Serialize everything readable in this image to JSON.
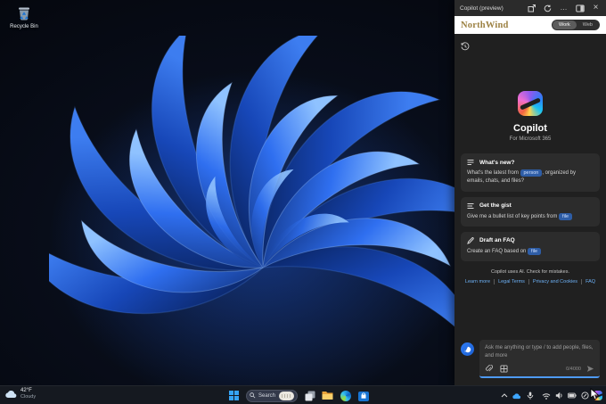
{
  "window": {
    "title": "Copilot (preview)"
  },
  "desktop": {
    "recycle_bin_label": "Recycle Bin"
  },
  "copilot_panel": {
    "brand_name": "NorthWind",
    "mode_toggle": {
      "options": [
        "Work",
        "Web"
      ],
      "selected": "Work"
    },
    "hero": {
      "app_name": "Copilot",
      "subtitle": "For Microsoft 365"
    },
    "prompt_cards": [
      {
        "title": "What's new?",
        "body_prefix": "What's the latest from ",
        "chip": "person",
        "body_suffix": ", organized by emails, chats, and files?"
      },
      {
        "title": "Get the gist",
        "body_prefix": "Give me a bullet list of key points from ",
        "chip": "file",
        "body_suffix": ""
      },
      {
        "title": "Draft an FAQ",
        "body_prefix": "Create an FAQ based on ",
        "chip": "file",
        "body_suffix": ""
      }
    ],
    "disclaimer": {
      "text": "Copilot uses AI. Check for mistakes.",
      "links": [
        "Learn more",
        "Legal Terms",
        "Privacy and Cookies",
        "FAQ"
      ]
    },
    "composer": {
      "placeholder": "Ask me anything or type / to add people, files, and more",
      "char_counter": "0/4000"
    }
  },
  "taskbar": {
    "weather": {
      "temperature": "42°F",
      "condition": "Cloudy"
    },
    "search_label": "Search"
  },
  "colors": {
    "accent_blue": "#4e9af5",
    "brand_gold": "#9c8142",
    "chip_bg": "#2e5da6",
    "link_blue": "#6cb0f5",
    "bloom_blue": "#2f6ff0"
  },
  "icons": {
    "more_options": "…",
    "close": "×"
  }
}
